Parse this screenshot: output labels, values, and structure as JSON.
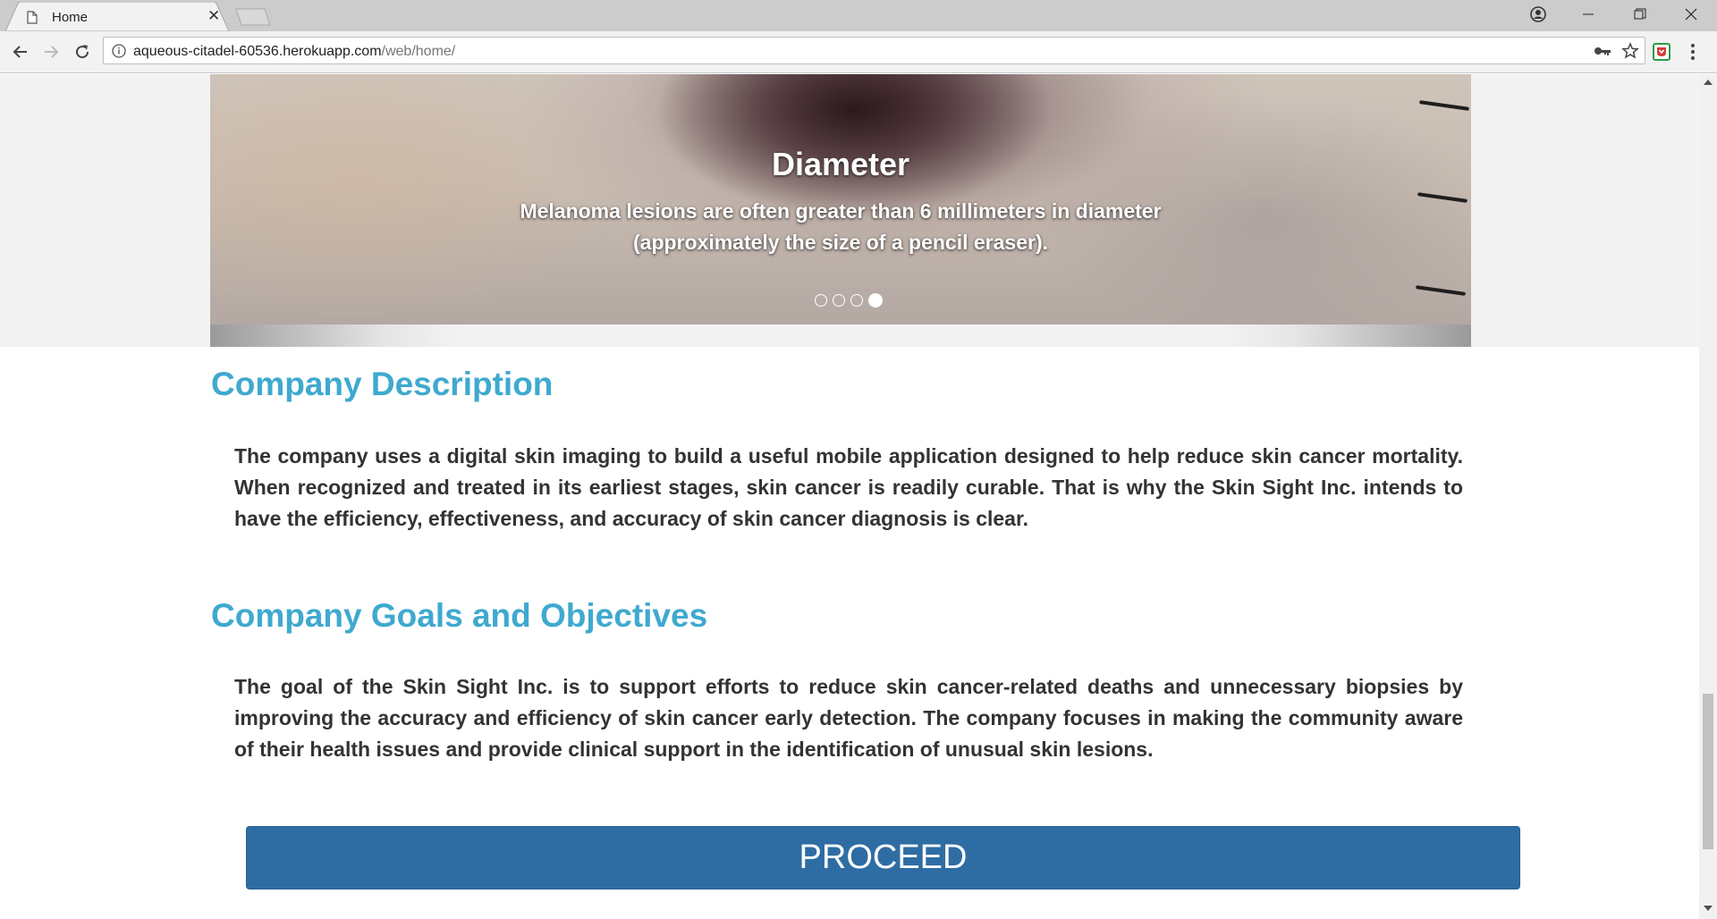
{
  "browser": {
    "tab_title": "Home",
    "tab_close": "✕",
    "url_host": "aqueous-citadel-60536.herokuapp.com",
    "url_path": "/web/home/"
  },
  "carousel": {
    "title": "Diameter",
    "text": "Melanoma lesions are often greater than 6 millimeters in diameter (approximately the size of a pencil eraser).",
    "slide_count": 4,
    "active_slide": 4
  },
  "description": {
    "title": "Company Description",
    "body": "The company uses a digital skin imaging to build a useful mobile application designed to help reduce skin cancer mortality. When recognized and treated in its earliest stages, skin cancer is readily curable. That is why the Skin Sight Inc. intends to have the efficiency, effectiveness, and accuracy of skin cancer diagnosis is clear."
  },
  "goals": {
    "title": "Company Goals and Objectives",
    "body": "The goal of the Skin Sight Inc. is to support efforts to reduce skin cancer-related deaths and unnecessary biopsies by improving the accuracy and efficiency of skin cancer early detection. The company focuses in making the community aware of their health issues and provide clinical support in the identification of unusual skin lesions."
  },
  "proceed_label": "PROCEED",
  "colors": {
    "heading": "#3fa9cf",
    "button": "#2e6da4",
    "body_text": "#333333"
  }
}
